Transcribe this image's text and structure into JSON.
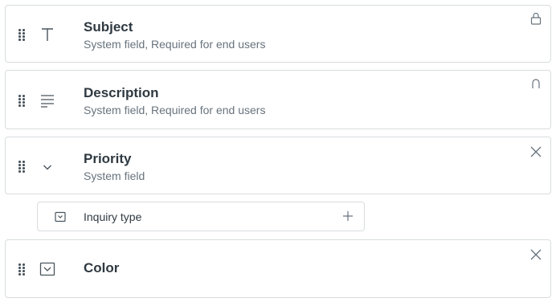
{
  "fields": [
    {
      "title": "Subject",
      "subtitle": "System field, Required for end users",
      "type_icon": "text-t-icon",
      "action_icon": "lock-icon"
    },
    {
      "title": "Description",
      "subtitle": "System field, Required for end users",
      "type_icon": "multiline-text-icon",
      "action_icon": "lock-icon"
    },
    {
      "title": "Priority",
      "subtitle": "System field",
      "type_icon": "chevron-down-icon",
      "action_icon": "close-icon"
    },
    {
      "title": "Color",
      "subtitle": "",
      "type_icon": "dropdown-box-icon",
      "action_icon": "close-icon"
    }
  ],
  "nested_field": {
    "label": "Inquiry type",
    "icon": "dropdown-box-icon",
    "action_icon": "plus-icon"
  },
  "colors": {
    "border": "#d8dcde",
    "title": "#2f3941",
    "subtitle": "#68737d",
    "icon": "#49545c"
  }
}
